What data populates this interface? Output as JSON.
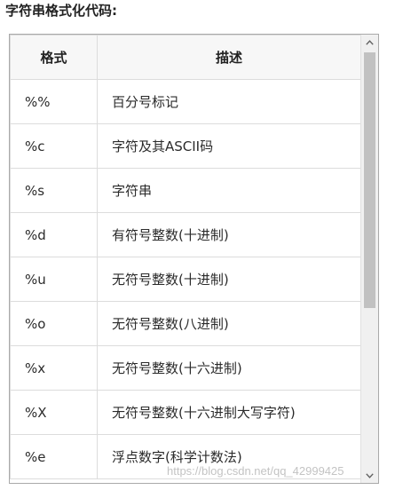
{
  "heading": "字符串格式化代码:",
  "table": {
    "headers": [
      "格式",
      "描述"
    ],
    "rows": [
      {
        "format": "%%",
        "description": "百分号标记"
      },
      {
        "format": "%c",
        "description": "字符及其ASCII码"
      },
      {
        "format": "%s",
        "description": "字符串"
      },
      {
        "format": "%d",
        "description": "有符号整数(十进制)"
      },
      {
        "format": "%u",
        "description": "无符号整数(十进制)"
      },
      {
        "format": "%o",
        "description": "无符号整数(八进制)"
      },
      {
        "format": "%x",
        "description": "无符号整数(十六进制)"
      },
      {
        "format": "%X",
        "description": "无符号整数(十六进制大写字符)"
      },
      {
        "format": "%e",
        "description": "浮点数字(科学计数法)"
      }
    ]
  },
  "scrollbar": {
    "up_icon": "chevron-up-icon",
    "down_icon": "chevron-down-icon",
    "position": 0.0
  },
  "watermark": "https://blog.csdn.net/qq_42999425"
}
